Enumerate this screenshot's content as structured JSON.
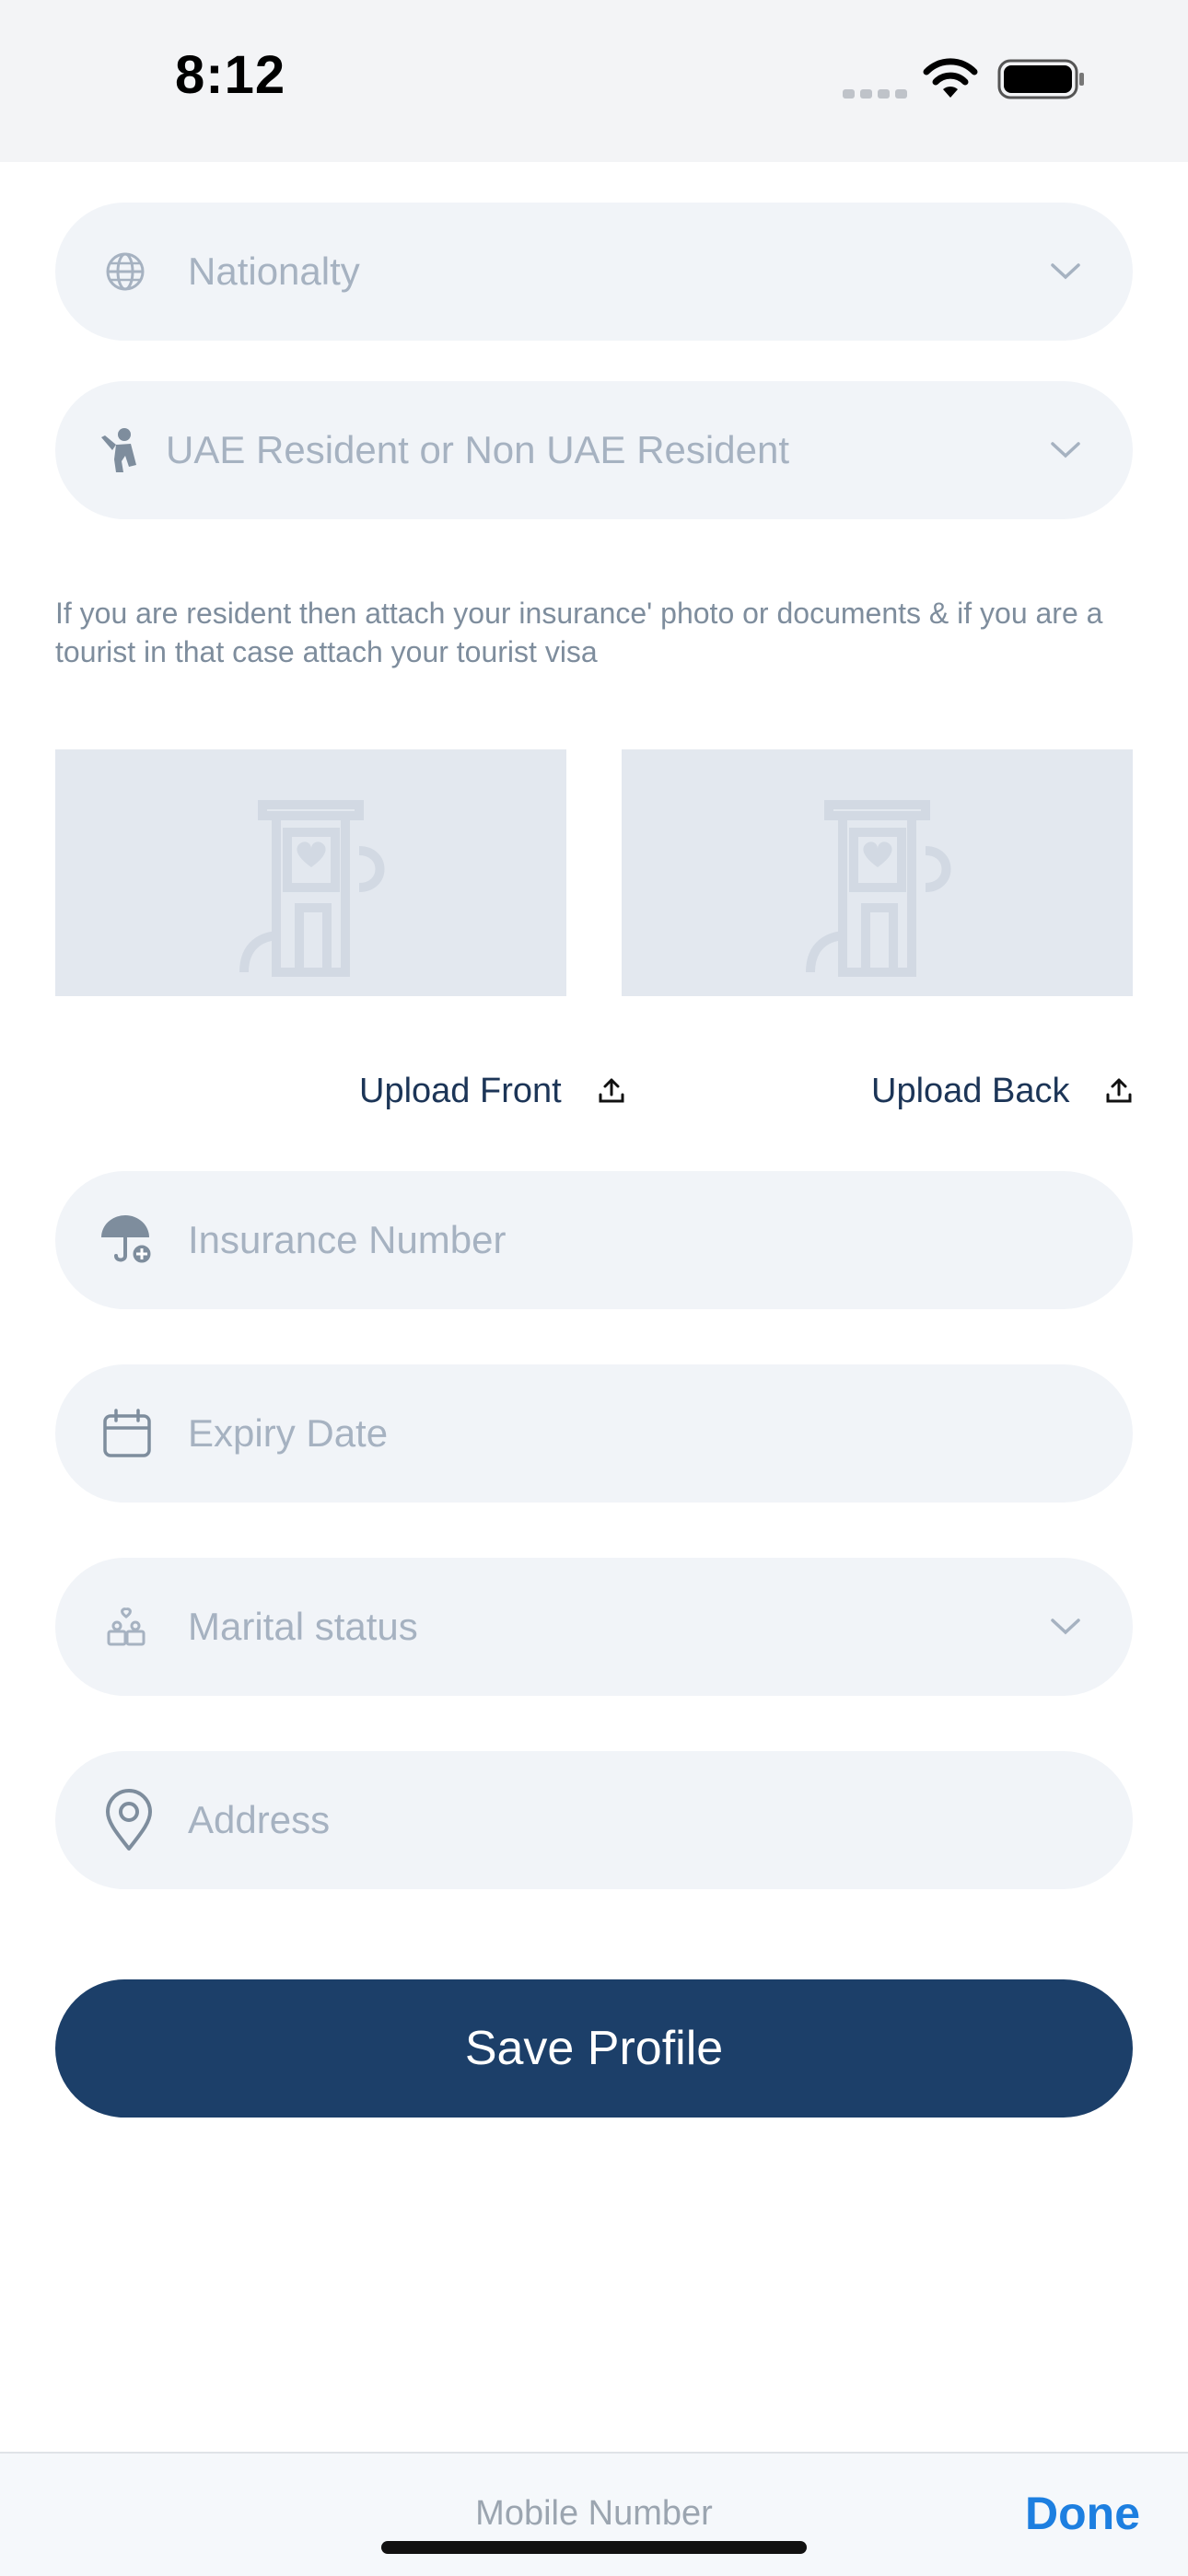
{
  "status_bar": {
    "time": "8:12"
  },
  "form": {
    "nationality": {
      "placeholder": "Nationalty",
      "icon": "globe-icon"
    },
    "residency": {
      "placeholder": "UAE Resident or Non UAE Resident",
      "icon": "person-wave-icon"
    },
    "help_text": "If you are resident then attach your insurance' photo or documents & if you are a tourist in that case attach your tourist visa",
    "upload_front_label": "Upload Front",
    "upload_back_label": "Upload Back",
    "insurance_number": {
      "placeholder": "Insurance Number",
      "icon": "umbrella-medical-icon"
    },
    "expiry_date": {
      "placeholder": "Expiry Date",
      "icon": "calendar-icon"
    },
    "marital_status": {
      "placeholder": "Marital status",
      "icon": "couple-icon"
    },
    "address": {
      "placeholder": "Address",
      "icon": "location-pin-icon"
    },
    "save_label": "Save Profile"
  },
  "keyboard_accessory": {
    "field_label": "Mobile Number",
    "done_label": "Done"
  },
  "colors": {
    "primary": "#1c3f69",
    "field_bg": "#f1f4f8",
    "placeholder": "#a6b2c1",
    "done": "#1d7fe0"
  }
}
